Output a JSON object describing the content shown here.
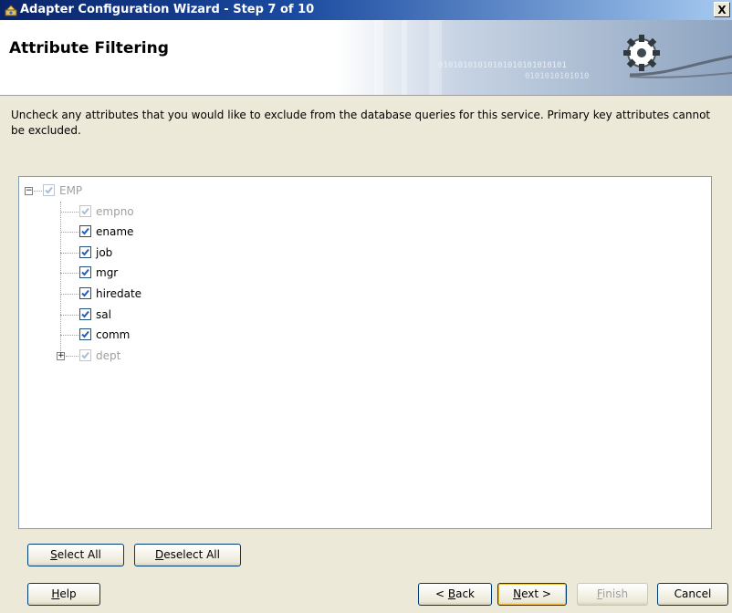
{
  "window": {
    "title": "Adapter Configuration Wizard - Step 7 of 10",
    "close_label": "X"
  },
  "banner": {
    "heading": "Attribute Filtering",
    "binary_text_1": "01010101010101010101010101",
    "binary_text_2": "0101010101010"
  },
  "instructions": "Uncheck any attributes that you would like to exclude from the database queries for this service.  Primary key attributes cannot be excluded.",
  "tree": {
    "root": {
      "label": "EMP",
      "checked": true,
      "disabled": true,
      "expander": "−"
    },
    "children": [
      {
        "label": "empno",
        "checked": true,
        "disabled": true
      },
      {
        "label": "ename",
        "checked": true,
        "disabled": false
      },
      {
        "label": "job",
        "checked": true,
        "disabled": false
      },
      {
        "label": "mgr",
        "checked": true,
        "disabled": false
      },
      {
        "label": "hiredate",
        "checked": true,
        "disabled": false
      },
      {
        "label": "sal",
        "checked": true,
        "disabled": false
      },
      {
        "label": "comm",
        "checked": true,
        "disabled": false
      },
      {
        "label": "dept",
        "checked": true,
        "disabled": true,
        "expander": "+"
      }
    ]
  },
  "buttons": {
    "select_all": {
      "mnemonic": "S",
      "rest": "elect All"
    },
    "deselect_all": {
      "mnemonic": "D",
      "rest": "eselect All"
    },
    "help": {
      "mnemonic": "H",
      "rest": "elp"
    },
    "back": {
      "pre": "< ",
      "mnemonic": "B",
      "rest": "ack"
    },
    "next": {
      "mnemonic": "N",
      "rest": "ext >"
    },
    "finish": {
      "mnemonic": "F",
      "rest": "inish",
      "disabled": true
    },
    "cancel": {
      "label": "Cancel"
    }
  },
  "colors": {
    "titlebar_start": "#0a246a",
    "checkbox_check": "#215dc6",
    "checkbox_check_disabled": "#a8bcd8"
  }
}
